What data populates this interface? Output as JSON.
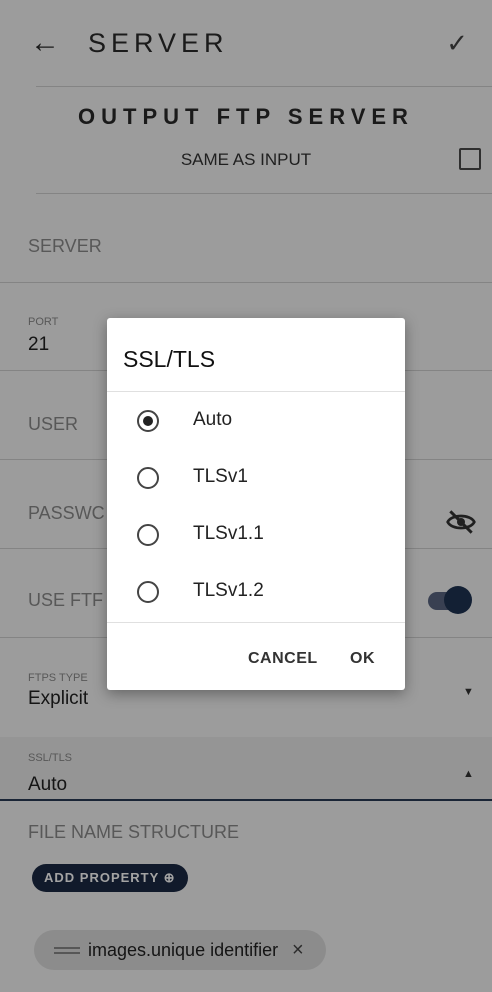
{
  "app_bar": {
    "back_icon": "arrow-left-icon",
    "title": "SERVER",
    "confirm_icon": "check-icon"
  },
  "section": {
    "title": "OUTPUT FTP SERVER",
    "same_as_input_label": "SAME AS INPUT",
    "same_as_input_checked": false
  },
  "fields": {
    "server_label": "SERVER",
    "port_label": "PORT",
    "port_value": "21",
    "user_label": "USER",
    "password_label": "PASSWC",
    "password_icon": "eye-off-icon",
    "use_ftps_label": "USE FTF",
    "use_ftps_on": true,
    "ftps_type_label": "FTPS TYPE",
    "ftps_type_value": "Explicit",
    "ssl_tls_label": "SSL/TLS",
    "ssl_tls_value": "Auto"
  },
  "file_name": {
    "label": "FILE NAME STRUCTURE",
    "add_property_label": "ADD PROPERTY ⊕",
    "chips": [
      {
        "text": "images.unique identifier",
        "remove": "×"
      }
    ]
  },
  "dialog": {
    "title": "SSL/TLS",
    "options": [
      "Auto",
      "TLSv1",
      "TLSv1.1",
      "TLSv1.2"
    ],
    "selected": "Auto",
    "cancel_label": "CANCEL",
    "ok_label": "OK"
  },
  "colors": {
    "accent": "#1c2a44",
    "toggle_knob": "#1f3352"
  }
}
